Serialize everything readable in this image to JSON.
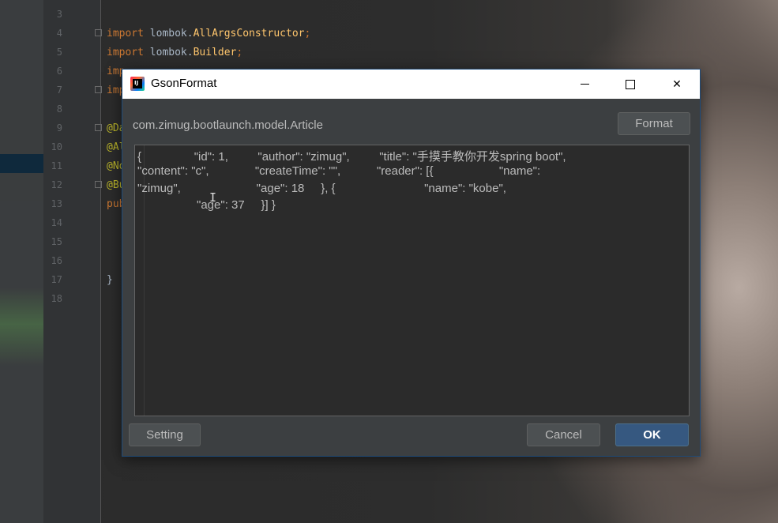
{
  "editor": {
    "line_numbers": [
      "3",
      "4",
      "5",
      "6",
      "7",
      "8",
      "9",
      "10",
      "11",
      "12",
      "13",
      "14",
      "15",
      "16",
      "17",
      "18"
    ],
    "code": {
      "l4_kw": "import",
      "l4_rest": " lombok.",
      "l4_cls": "AllArgsConstructor",
      "l4_end": ";",
      "l5_kw": "import",
      "l5_rest": " lombok.",
      "l5_cls": "Builder",
      "l5_end": ";",
      "l6": "imp",
      "l7": "imp",
      "l9": "@Da",
      "l10": "@Al",
      "l11": "@No",
      "l12": "@Bu",
      "l13": "pub",
      "l17": "}"
    }
  },
  "dialog": {
    "title": "GsonFormat",
    "app_icon_text": "IJ",
    "class_name": "com.zimug.bootlaunch.model.Article",
    "format_label": "Format",
    "json_lines": [
      "{                \"id\": 1,         \"author\": \"zimug\",         \"title\": \"手摸手教你开发spring boot\",",
      "\"content\": \"c\",              \"createTime\": \"\",           \"reader\": [{                    \"name\":",
      "\"zimug\",                       \"age\": 18     }, {                           \"name\": \"kobe\",",
      "                  \"age\": 37     }] }"
    ],
    "setting_label": "Setting",
    "cancel_label": "Cancel",
    "ok_label": "OK"
  }
}
